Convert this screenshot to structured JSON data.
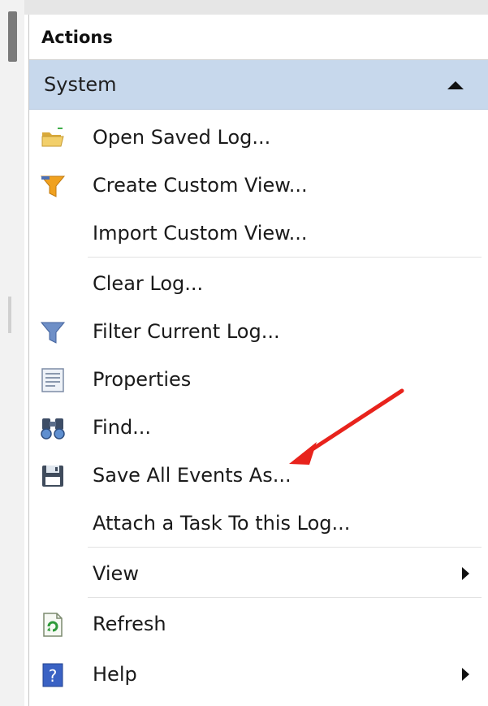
{
  "panel": {
    "title": "Actions",
    "section": {
      "label": "System",
      "expanded": true
    },
    "items": [
      {
        "label": "Open Saved Log...",
        "icon": "open-folder-icon"
      },
      {
        "label": "Create Custom View...",
        "icon": "filter-funnel-icon"
      },
      {
        "label": "Import Custom View...",
        "icon": null
      },
      {
        "label": "Clear Log...",
        "icon": null
      },
      {
        "label": "Filter Current Log...",
        "icon": "filter-icon"
      },
      {
        "label": "Properties",
        "icon": "properties-icon"
      },
      {
        "label": "Find...",
        "icon": "binoculars-icon"
      },
      {
        "label": "Save All Events As...",
        "icon": "save-disk-icon"
      },
      {
        "label": "Attach a Task To this Log...",
        "icon": null
      },
      {
        "label": "View",
        "icon": null,
        "submenu": true
      },
      {
        "label": "Refresh",
        "icon": "refresh-icon"
      },
      {
        "label": "Help",
        "icon": "help-icon",
        "submenu": true
      }
    ]
  },
  "colors": {
    "section_bg": "#c7d8ec",
    "annotation_arrow": "#e8231c"
  }
}
